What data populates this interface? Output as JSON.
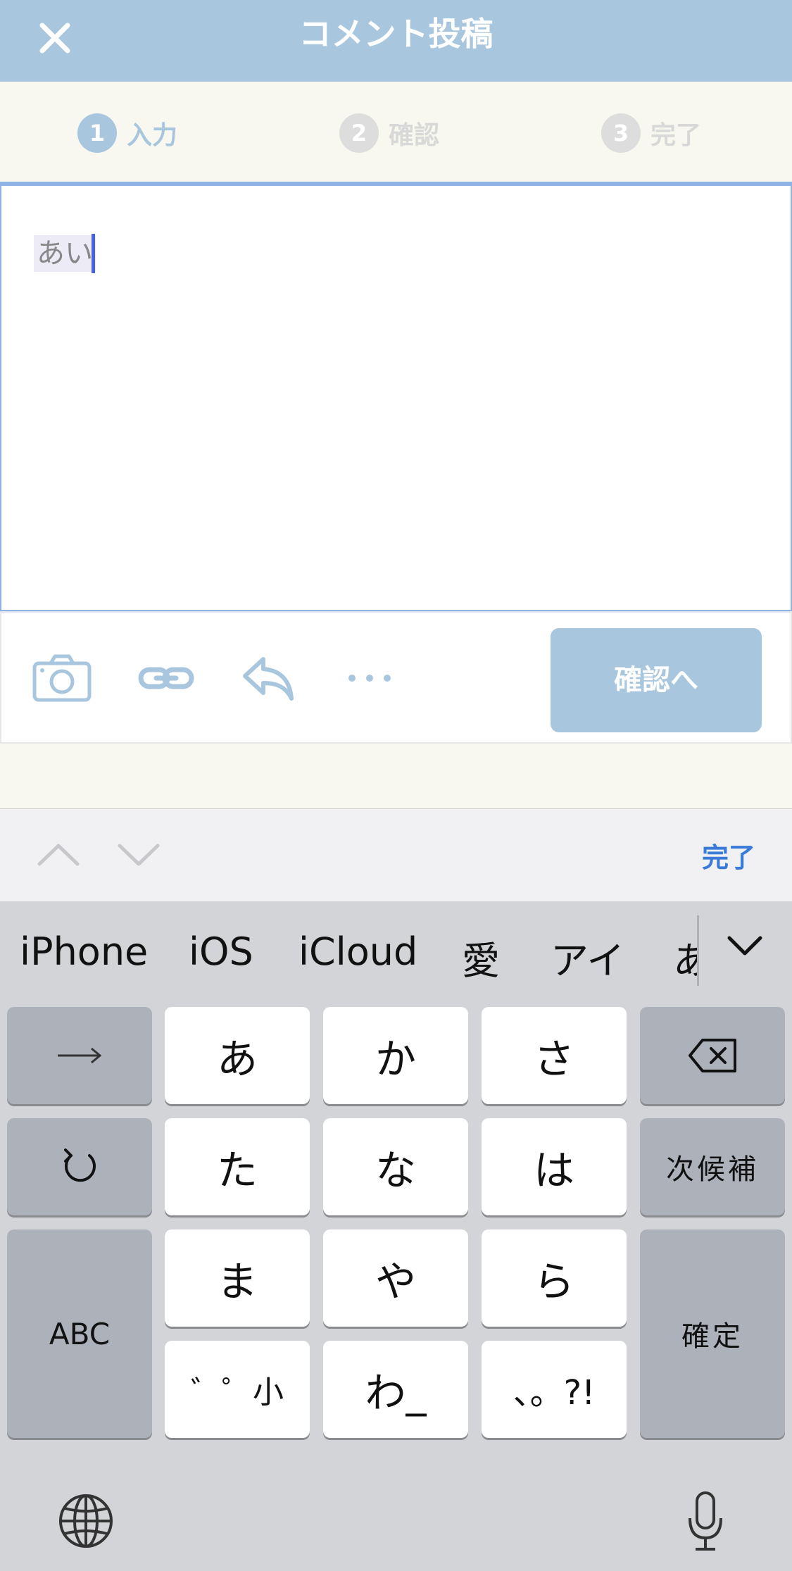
{
  "header": {
    "title": "コメント投稿"
  },
  "steps": [
    {
      "num": "1",
      "label": "入力",
      "state": "active"
    },
    {
      "num": "2",
      "label": "確認",
      "state": "inactive"
    },
    {
      "num": "3",
      "label": "完了",
      "state": "inactive"
    }
  ],
  "editor": {
    "text": "あい"
  },
  "toolbar": {
    "confirm_label": "確認へ"
  },
  "accessory": {
    "done_label": "完了"
  },
  "keyboard": {
    "candidates": [
      "iPhone",
      "iOS",
      "iCloud",
      "愛",
      "アイ",
      "あ"
    ],
    "keys": {
      "a": "あ",
      "ka": "か",
      "sa": "さ",
      "ta": "た",
      "na": "な",
      "ha": "は",
      "ma": "ま",
      "ya": "や",
      "ra": "ら",
      "dakuten": "゛゜小",
      "wa": "わ_",
      "punct": "、。?!",
      "next_candidate": "次候補",
      "abc": "ABC",
      "confirm": "確定"
    }
  },
  "colors": {
    "header": "#a8c6de",
    "accent_blue": "#3a7bd8",
    "caret": "#4a63d8"
  }
}
